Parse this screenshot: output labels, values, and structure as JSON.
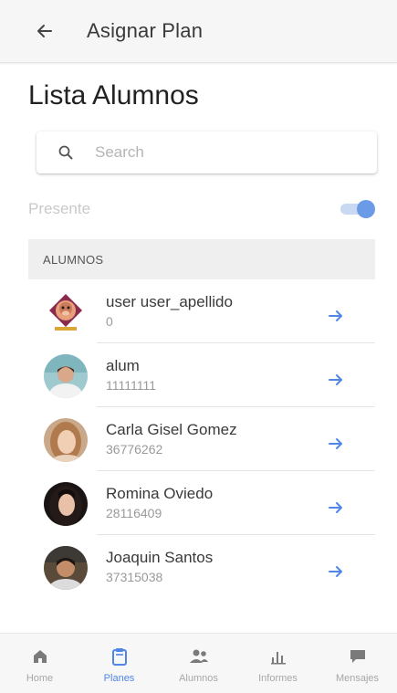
{
  "appbar": {
    "title": "Asignar Plan",
    "back_icon": "arrow-left-icon"
  },
  "page": {
    "title": "Lista Alumnos"
  },
  "search": {
    "placeholder": "Search",
    "value": "",
    "icon": "search-icon"
  },
  "filter": {
    "label": "Presente",
    "toggle_on": true,
    "accent": "#6b9be6"
  },
  "section": {
    "header": "ALUMNOS"
  },
  "students": [
    {
      "name": "user user_apellido",
      "id": "0",
      "avatar": "avatar-monkey-icon"
    },
    {
      "name": "alum",
      "id": "11111111",
      "avatar": "avatar-man-photo"
    },
    {
      "name": "Carla Gisel Gomez",
      "id": "36776262",
      "avatar": "avatar-woman-photo"
    },
    {
      "name": "Romina Oviedo",
      "id": "28116409",
      "avatar": "avatar-woman-dark-photo"
    },
    {
      "name": "Joaquin Santos",
      "id": "37315038",
      "avatar": "avatar-boy-photo"
    }
  ],
  "nav": {
    "items": [
      {
        "label": "Home",
        "icon": "home-icon",
        "active": false
      },
      {
        "label": "Planes",
        "icon": "clipboard-icon",
        "active": true
      },
      {
        "label": "Alumnos",
        "icon": "students-icon",
        "active": false
      },
      {
        "label": "Informes",
        "icon": "bar-chart-icon",
        "active": false
      },
      {
        "label": "Mensajes",
        "icon": "chat-icon",
        "active": false
      }
    ],
    "active_color": "#4f86e8",
    "inactive_color": "#7a7a7a"
  }
}
